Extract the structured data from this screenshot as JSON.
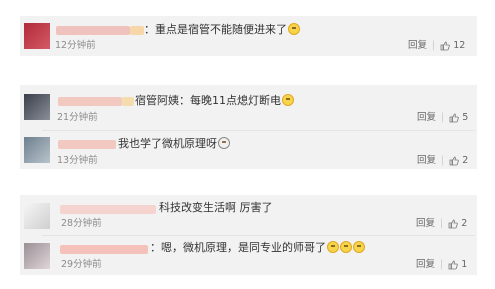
{
  "comments": [
    {
      "text": "：重点是宿管不能随便进来了",
      "time": "12分钟前",
      "reply_label": "回复",
      "likes": "12",
      "emoji": "smiley-emoji"
    },
    {
      "text": "宿管阿姨：每晚11点熄灯断电",
      "time": "21分钟前",
      "reply_label": "回复",
      "likes": "5",
      "emoji": "smiley-emoji"
    },
    {
      "text": "我也学了微机原理呀",
      "time": "13分钟前",
      "reply_label": "回复",
      "likes": "2",
      "emoji": "tearful-emoji"
    },
    {
      "text": "科技改变生活啊 厉害了",
      "time": "28分钟前",
      "reply_label": "回复",
      "likes": "2",
      "emoji": ""
    },
    {
      "text": "：嗯，微机原理，是同专业的师哥了",
      "time": "29分钟前",
      "reply_label": "回复",
      "likes": "1",
      "emoji": "smiley-emoji"
    }
  ],
  "colors": {
    "card_bg": "#f2f2f2",
    "text": "#333333",
    "meta": "#8c8c8c",
    "blur_name": "#f0b9b4"
  }
}
